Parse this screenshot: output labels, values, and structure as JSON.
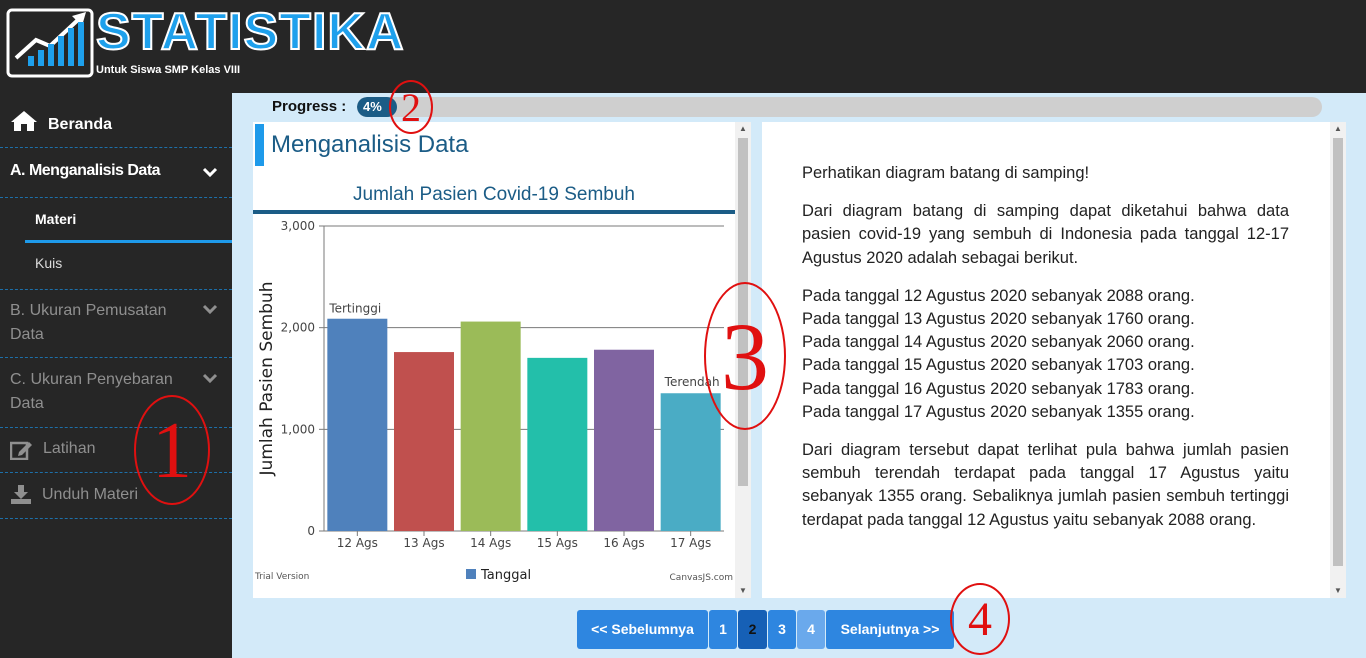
{
  "app": {
    "title": "STATISTIKA",
    "subtitle": "Untuk Siswa SMP Kelas VIII"
  },
  "sidebar": {
    "items": [
      {
        "label": "Beranda",
        "icon": "home-icon"
      },
      {
        "label": "A. Menganalisis Data",
        "icon": "chevron-down-icon"
      },
      {
        "label": "Materi"
      },
      {
        "label": "Kuis"
      },
      {
        "label": "B. Ukuran Pemusatan Data",
        "icon": "chevron-down-icon"
      },
      {
        "label": "C. Ukuran Penyebaran Data",
        "icon": "chevron-down-icon"
      },
      {
        "label": "Latihan",
        "icon": "edit-icon"
      },
      {
        "label": "Unduh Materi",
        "icon": "download-icon"
      }
    ]
  },
  "progress": {
    "label": "Progress :",
    "value_text": "4%",
    "value": 0.04
  },
  "content": {
    "section_title": "Menganalisis Data",
    "paragraphs": [
      "Perhatikan diagram batang di samping!",
      "Dari diagram batang di samping dapat diketahui bahwa data pasien covid-19 yang sembuh di Indonesia pada tanggal 12-17 Agustus 2020 adalah sebagai berikut.",
      "Dari diagram tersebut dapat terlihat pula bahwa jumlah pasien sembuh terendah terdapat pada tanggal 17 Agustus yaitu sebanyak 1355 orang. Sebaliknya jumlah pasien sembuh tertinggi terdapat pada tanggal 12 Agustus yaitu sebanyak 2088 orang."
    ],
    "lines": [
      "Pada tanggal 12 Agustus 2020 sebanyak 2088 orang.",
      "Pada tanggal 13 Agustus 2020 sebanyak 1760 orang.",
      "Pada tanggal 14 Agustus 2020 sebanyak 2060 orang.",
      "Pada tanggal 15 Agustus 2020 sebanyak 1703 orang.",
      "Pada tanggal 16 Agustus 2020 sebanyak 1783 orang.",
      "Pada tanggal 17 Agustus 2020 sebanyak 1355 orang."
    ]
  },
  "chart_data": {
    "type": "bar",
    "title": "Jumlah Pasien Covid-19 Sembuh",
    "ylabel": "Jumlah Pasien Sembuh",
    "xlabel": "",
    "categories": [
      "12 Ags",
      "13 Ags",
      "14 Ags",
      "15 Ags",
      "16 Ags",
      "17 Ags"
    ],
    "values": [
      2088,
      1760,
      2060,
      1703,
      1783,
      1355
    ],
    "colors": [
      "#4f81bc",
      "#c0504e",
      "#9bbb58",
      "#23bfaa",
      "#8064a1",
      "#4aacc5"
    ],
    "ylim": [
      0,
      3000
    ],
    "yticks": [
      "0",
      "1,000",
      "2,000",
      "3,000"
    ],
    "annotations": {
      "max": "Tertinggi",
      "min": "Terendah"
    },
    "legend": {
      "label": "Tanggal",
      "color": "#4f81bc",
      "placement": "bottom"
    },
    "watermark_left": "Trial Version",
    "watermark_right": "CanvasJS.com",
    "grid": true
  },
  "pagination": {
    "prev": "<< Sebelumnya",
    "pages": [
      "1",
      "2",
      "3",
      "4"
    ],
    "next": "Selanjutnya >>"
  },
  "annotations": [
    "1",
    "2",
    "3",
    "4"
  ],
  "colors": {
    "accent": "#1e9aea",
    "dark": "#262626",
    "main_bg": "#d3eaf9",
    "annotation": "#e01010"
  }
}
